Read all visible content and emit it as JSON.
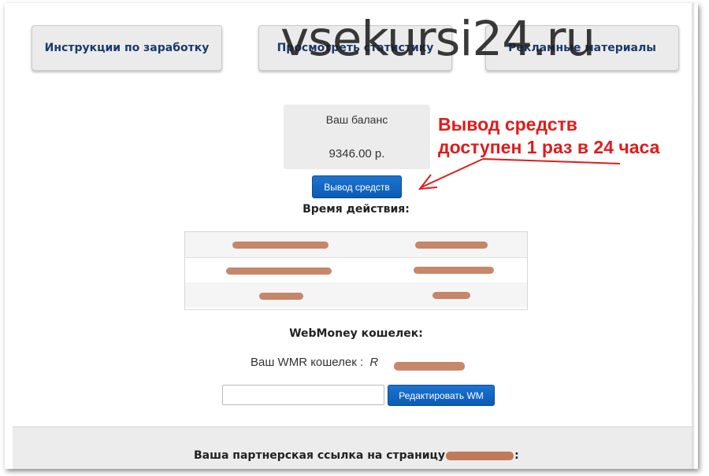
{
  "tabs": [
    {
      "label": "Инструкции по заработку"
    },
    {
      "label": "Просмотреть статистику"
    },
    {
      "label": "Рекламные материалы"
    }
  ],
  "watermark": "vsekursi24.ru",
  "balance": {
    "label": "Ваш баланс",
    "value": "9346.00 р."
  },
  "withdraw_button": "Вывод средств",
  "annotation": {
    "line1": "Вывод средств",
    "line2": "доступен 1 раз в 24 часа",
    "color": "#e01b1b"
  },
  "validity_heading": "Время действия:",
  "webmoney": {
    "heading": "WebMoney кошелек:",
    "wallet_label": "Ваш WMR кошелек :",
    "wallet_prefix": "R",
    "input_value": "",
    "edit_button": "Редактировать WM"
  },
  "partner_link_label": "Ваша партнерская ссылка на страницу",
  "partner_link_suffix": ":",
  "colors": {
    "accent_blue": "#0a5bb5",
    "tab_text": "#1a3a6e"
  }
}
